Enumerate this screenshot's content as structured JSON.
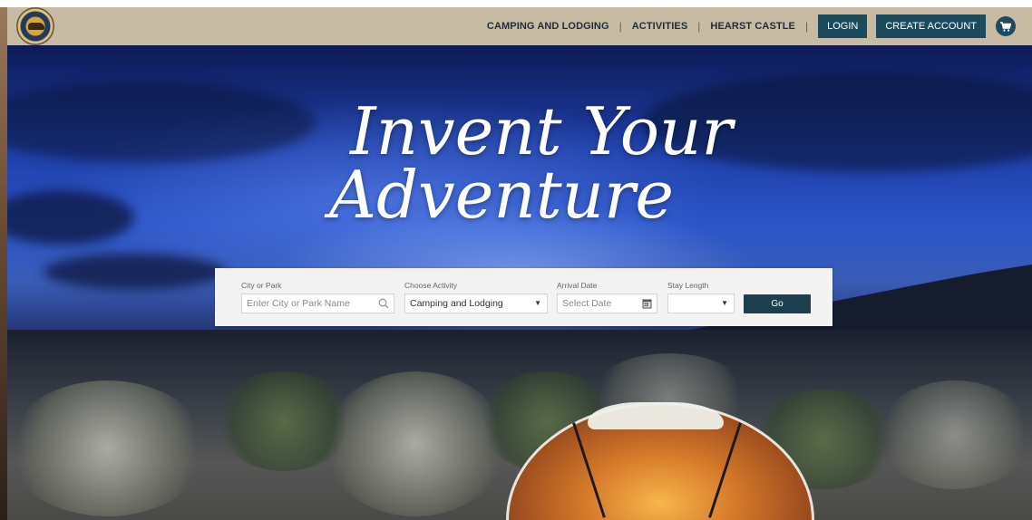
{
  "nav": {
    "camping": "CAMPING AND LODGING",
    "activities": "ACTIVITIES",
    "hearst": "HEARST CASTLE",
    "separator": "|",
    "login": "LOGIN",
    "create_account": "CREATE ACCOUNT"
  },
  "logo": {
    "icon": "california-state-parks-seal"
  },
  "hero": {
    "line1": "Invent Your",
    "line2": "Adventure"
  },
  "search": {
    "city_label": "City or Park",
    "city_placeholder": "Enter City or Park Name",
    "activity_label": "Choose Activity",
    "activity_value": "Camping and Lodging",
    "arrival_label": "Arrival Date",
    "arrival_placeholder": "Select Date",
    "stay_label": "Stay Length",
    "stay_value": "",
    "go_label": "Go"
  },
  "colors": {
    "header_bg": "#c8bba4",
    "accent": "#1c4b5e",
    "go_button": "#1c3f4d"
  }
}
